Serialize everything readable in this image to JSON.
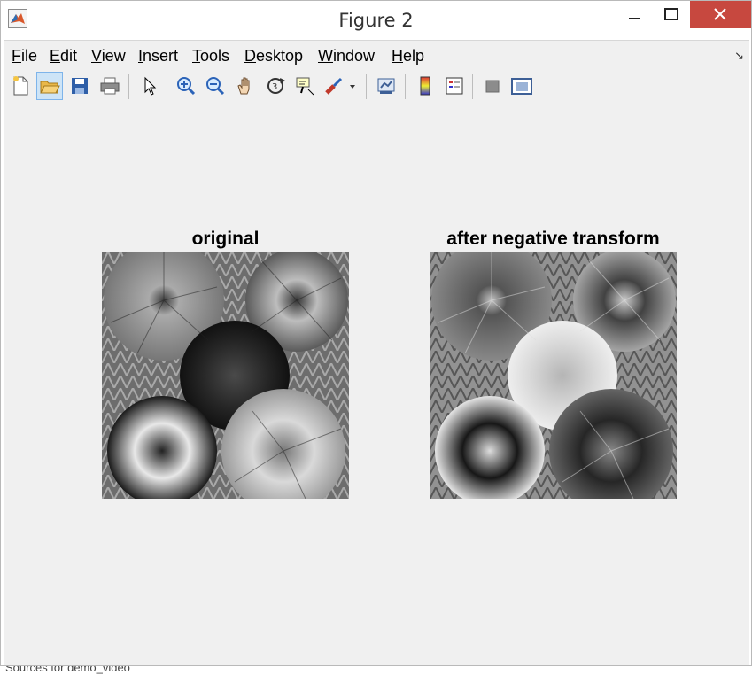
{
  "window": {
    "title": "Figure 2"
  },
  "menu": [
    "File",
    "Edit",
    "View",
    "Insert",
    "Tools",
    "Desktop",
    "Window",
    "Help"
  ],
  "toolbar": {
    "icons": [
      "new-figure-icon",
      "open-file-icon",
      "save-icon",
      "print-icon",
      "edit-plot-arrow-icon",
      "zoom-in-icon",
      "zoom-out-icon",
      "pan-hand-icon",
      "rotate-3d-icon",
      "data-cursor-icon",
      "brush-icon",
      "link-plot-icon",
      "colorbar-icon",
      "legend-icon",
      "hide-plot-tools-icon",
      "show-plot-tools-icon"
    ]
  },
  "axes": [
    {
      "title": "original"
    },
    {
      "title": "after negative transform"
    }
  ],
  "footer": {
    "partial_text": "Sources for demo_video"
  }
}
